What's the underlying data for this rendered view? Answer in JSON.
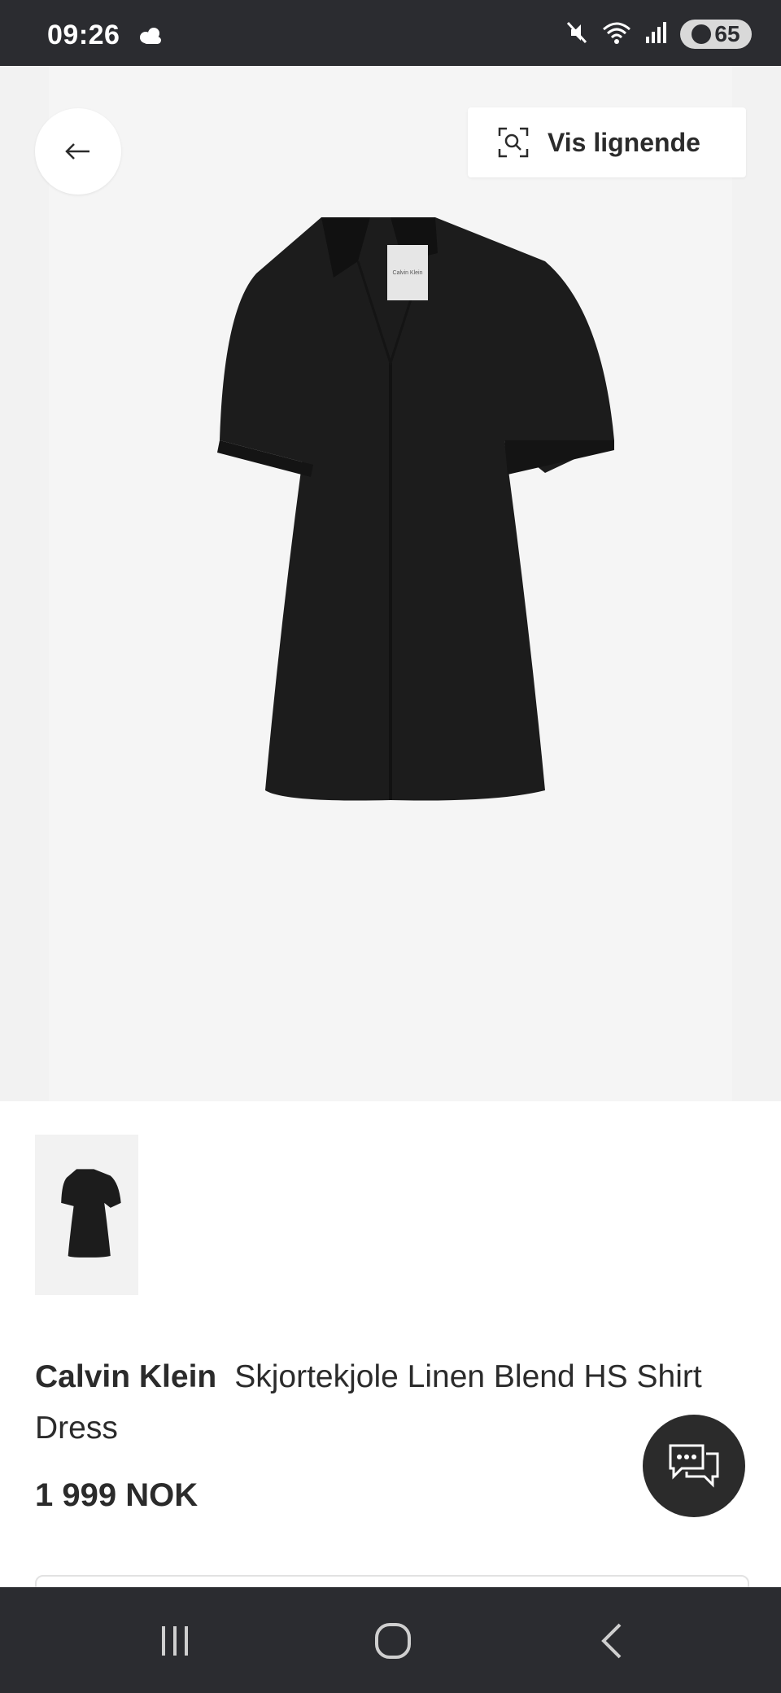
{
  "status_bar": {
    "time": "09:26",
    "battery_level": "65",
    "icons": [
      "cloud-icon",
      "mute-icon",
      "wifi-icon",
      "signal-icon",
      "battery-icon"
    ]
  },
  "hero": {
    "back_icon": "arrow-left-icon",
    "similar_button_label": "Vis lignende",
    "similar_icon": "visual-search-icon"
  },
  "product": {
    "brand": "Calvin Klein",
    "name": "Skjortekjole Linen Blend HS Shirt Dress",
    "price": "1 999 NOK",
    "label_text": "Calvin Klein",
    "thumbnails_count": 1
  },
  "chat": {
    "icon": "chat-bubbles-icon"
  },
  "nav_bar": {
    "items": [
      "recent-apps-icon",
      "home-icon",
      "back-icon"
    ]
  },
  "colors": {
    "status_bg": "#2b2c30",
    "hero_bg": "#f2f2f2",
    "dress": "#1c1c1c",
    "text": "#2b2b2b"
  }
}
